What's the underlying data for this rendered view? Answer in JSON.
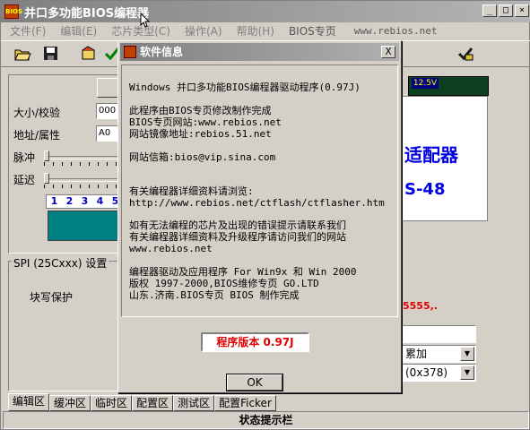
{
  "window": {
    "title": "并口多功能BIOS编程器",
    "icon_text": "BIOS"
  },
  "menu": {
    "items": [
      "文件(F)",
      "编辑(E)",
      "芯片类型(C)",
      "操作(A)",
      "帮助(H)",
      "BIOS专页"
    ],
    "url": "www.rebios.net"
  },
  "left": {
    "size_label": "大小/校验",
    "size_value": "000",
    "addr_label": "地址/属性",
    "addr_value": "A0",
    "pulse_label": "脉冲",
    "delay_label": "延迟",
    "numbers": [
      "1",
      "2",
      "3",
      "4",
      "5"
    ]
  },
  "spi": {
    "group_title": "SPI (25Cxxx) 设置",
    "write_protect_label": "块写保护"
  },
  "right": {
    "voltage": "12.5V",
    "adapter_text": "适配器",
    "adapter_num": "S-48",
    "red_text": "5555,.",
    "combo1_value": "累加",
    "combo2_value": "(0x378)"
  },
  "tabs": [
    "编辑区",
    "缓冲区",
    "临时区",
    "配置区",
    "测试区",
    "配置Ficker"
  ],
  "status": "状态提示栏",
  "dialog": {
    "title": "软件信息",
    "close": "X",
    "lines": [
      "Windows 并口多功能BIOS编程器驱动程序(0.97J)",
      "此程序由BIOS专页修改制作完成",
      "BIOS专页网站:www.rebios.net",
      "网站镜像地址:rebios.51.net",
      "网站信箱:bios@vip.sina.com",
      "有关编程器详细资料请浏览:",
      "http://www.rebios.net/ctflash/ctflasher.htm",
      "如有无法编程的芯片及出现的错误提示请联系我们",
      "有关编程器详细资料及升级程序请访问我们的网站",
      "www.rebios.net",
      "编程器驱动及应用程序 For Win9x 和 Win 2000",
      "版权 1997-2000,BIOS维修专页 GO.LTD",
      "山东.济南.BIOS专页 BIOS 制作完成"
    ],
    "version": "程序版本 0.97J",
    "ok_label": "OK"
  }
}
